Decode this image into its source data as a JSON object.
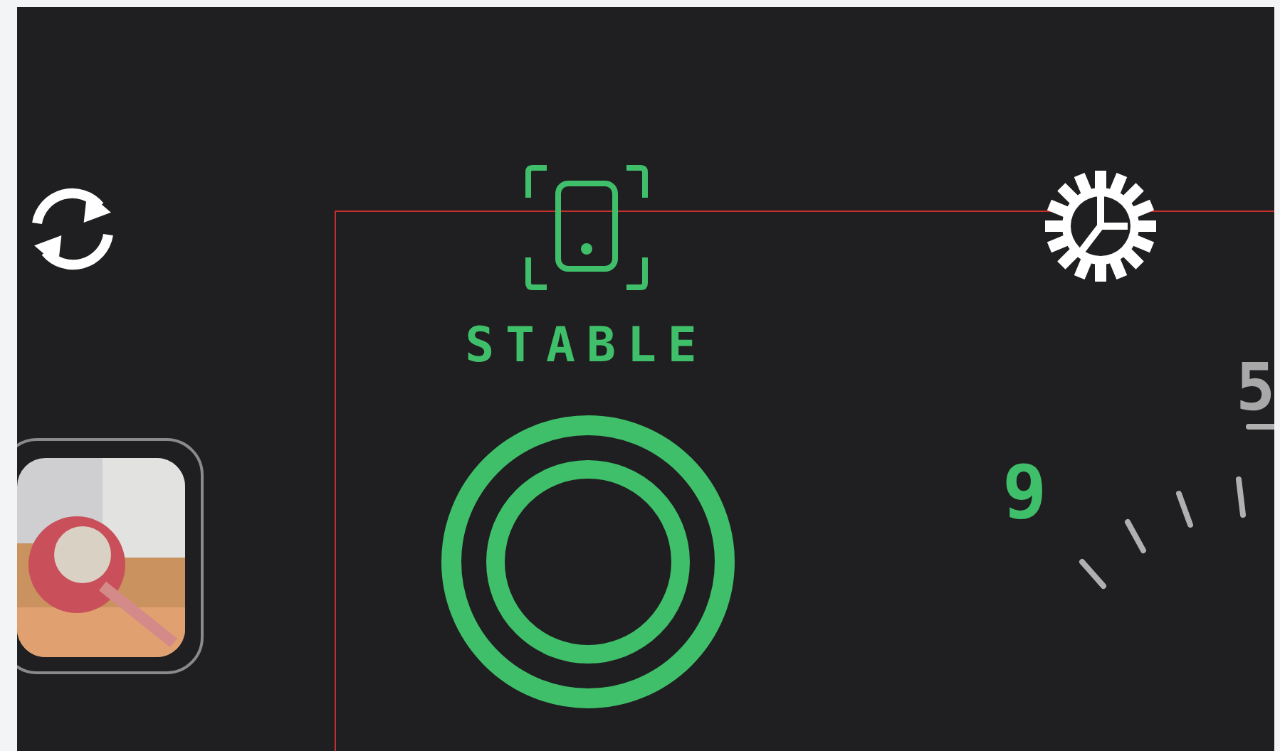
{
  "status": {
    "label": "STABLE",
    "stable": true
  },
  "dial": {
    "labels": [
      {
        "text": "9",
        "selected": true
      },
      {
        "text": "5",
        "selected": false
      }
    ]
  }
}
